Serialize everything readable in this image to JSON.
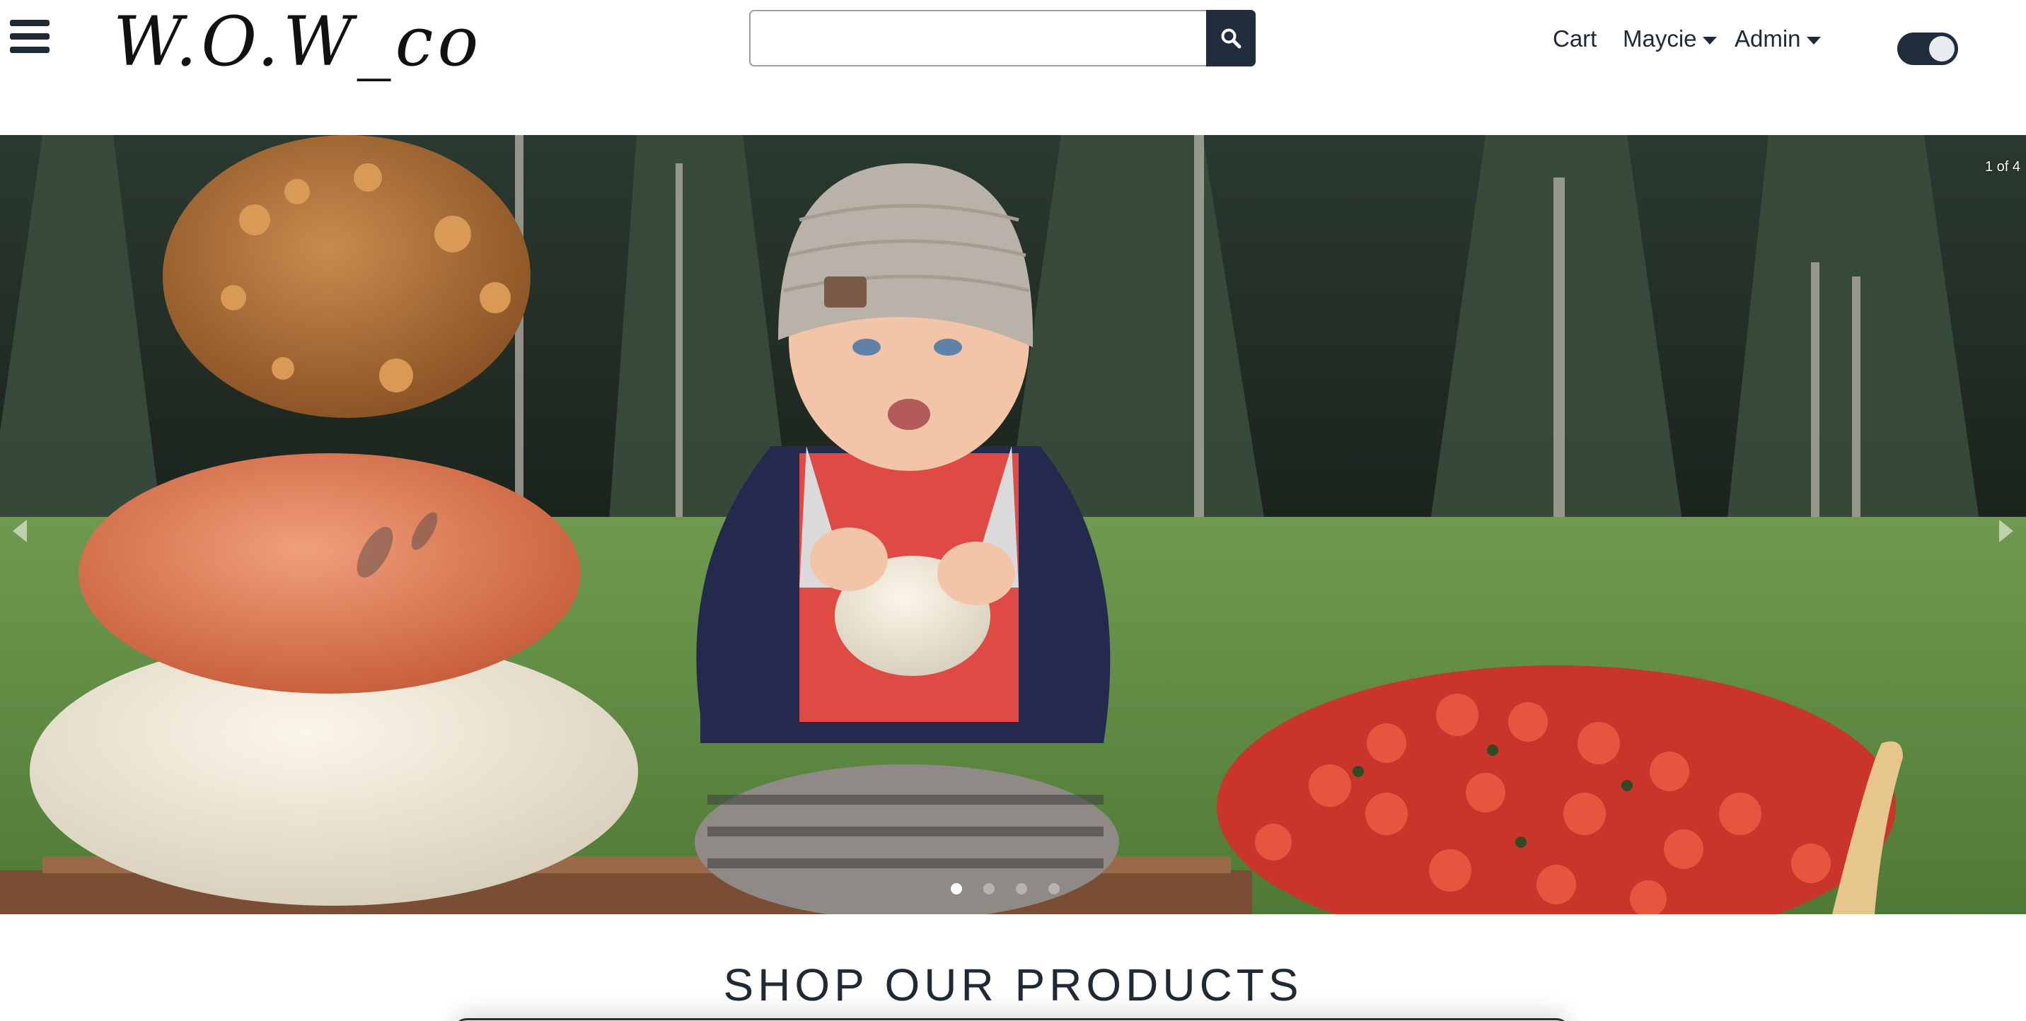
{
  "header": {
    "logo_text": "W.O.W_co",
    "search": {
      "value": "",
      "placeholder": ""
    },
    "nav": {
      "cart_label": "Cart",
      "user_label": "Maycie",
      "admin_label": "Admin"
    },
    "dark_mode_toggle": {
      "on": true
    }
  },
  "hero": {
    "slide_counter": "1 of 4",
    "slide_count": 4,
    "active_slide": 1
  },
  "shop": {
    "title": "SHOP OUR PRODUCTS"
  },
  "colors": {
    "navy": "#1f2d3d",
    "text": "#1f2a36",
    "white": "#ffffff"
  }
}
